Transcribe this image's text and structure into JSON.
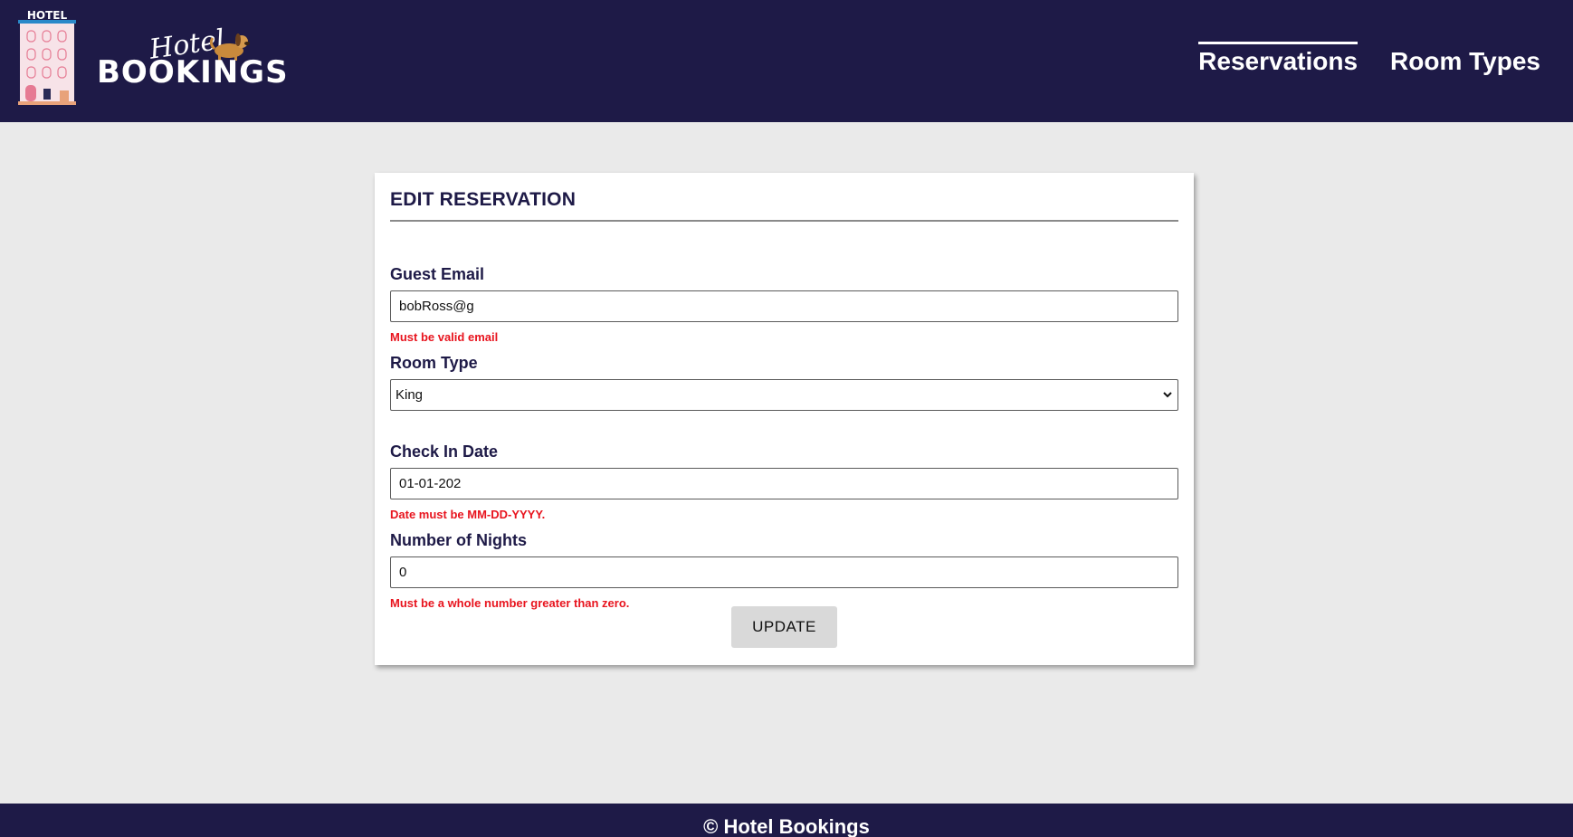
{
  "header": {
    "logo": {
      "building_label": "HOTEL",
      "hotel_word": "Hotel",
      "bookings_word": "BOOKINGS"
    },
    "nav": [
      {
        "label": "Reservations",
        "active": true
      },
      {
        "label": "Room Types",
        "active": false
      }
    ]
  },
  "form": {
    "title": "EDIT RESERVATION",
    "guest_email": {
      "label": "Guest Email",
      "value": "bobRoss@g",
      "error": "Must be valid email"
    },
    "room_type": {
      "label": "Room Type",
      "selected": "King",
      "error": ""
    },
    "check_in_date": {
      "label": "Check In Date",
      "value": "01-01-202",
      "error": "Date must be MM-DD-YYYY."
    },
    "number_of_nights": {
      "label": "Number of Nights",
      "value": "0",
      "error": "Must be a whole number greater than zero."
    },
    "submit_label": "UPDATE"
  },
  "footer": {
    "text": "© Hotel Bookings"
  },
  "colors": {
    "header_bg": "#1e1a47",
    "page_bg": "#eaeaea",
    "error": "#e8141e",
    "button_bg": "#d9d9d9"
  }
}
